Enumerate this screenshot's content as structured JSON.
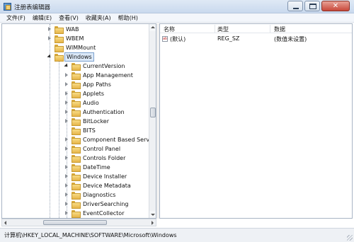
{
  "window": {
    "title": "注册表编辑器",
    "close_glyph": "✕"
  },
  "menu": [
    "文件(F)",
    "编辑(E)",
    "查看(V)",
    "收藏夹(A)",
    "帮助(H)"
  ],
  "tree": {
    "items": [
      {
        "label": "WAB",
        "expander": "collapsed"
      },
      {
        "label": "WBEM",
        "expander": "collapsed"
      },
      {
        "label": "WIMMount",
        "expander": "none"
      },
      {
        "label": "Windows",
        "expander": "expanded",
        "selected": true
      },
      {
        "label": "CurrentVersion",
        "expander": "expanded"
      },
      {
        "label": "App Management",
        "expander": "collapsed"
      },
      {
        "label": "App Paths",
        "expander": "collapsed"
      },
      {
        "label": "Applets",
        "expander": "collapsed"
      },
      {
        "label": "Audio",
        "expander": "collapsed"
      },
      {
        "label": "Authentication",
        "expander": "collapsed"
      },
      {
        "label": "BitLocker",
        "expander": "collapsed"
      },
      {
        "label": "BITS",
        "expander": "none"
      },
      {
        "label": "Component Based Servicin",
        "expander": "collapsed"
      },
      {
        "label": "Control Panel",
        "expander": "collapsed"
      },
      {
        "label": "Controls Folder",
        "expander": "collapsed"
      },
      {
        "label": "DateTime",
        "expander": "collapsed"
      },
      {
        "label": "Device Installer",
        "expander": "collapsed"
      },
      {
        "label": "Device Metadata",
        "expander": "collapsed"
      },
      {
        "label": "Diagnostics",
        "expander": "collapsed"
      },
      {
        "label": "DriverSearching",
        "expander": "collapsed"
      },
      {
        "label": "EventCollector",
        "expander": "collapsed"
      }
    ]
  },
  "list": {
    "columns": [
      "名称",
      "类型",
      "数据"
    ],
    "rows": [
      {
        "name": "(默认)",
        "type": "REG_SZ",
        "data": "(数值未设置)",
        "icon": "ab"
      }
    ]
  },
  "status": {
    "path": "计算机\\HKEY_LOCAL_MACHINE\\SOFTWARE\\Microsoft\\Windows"
  }
}
